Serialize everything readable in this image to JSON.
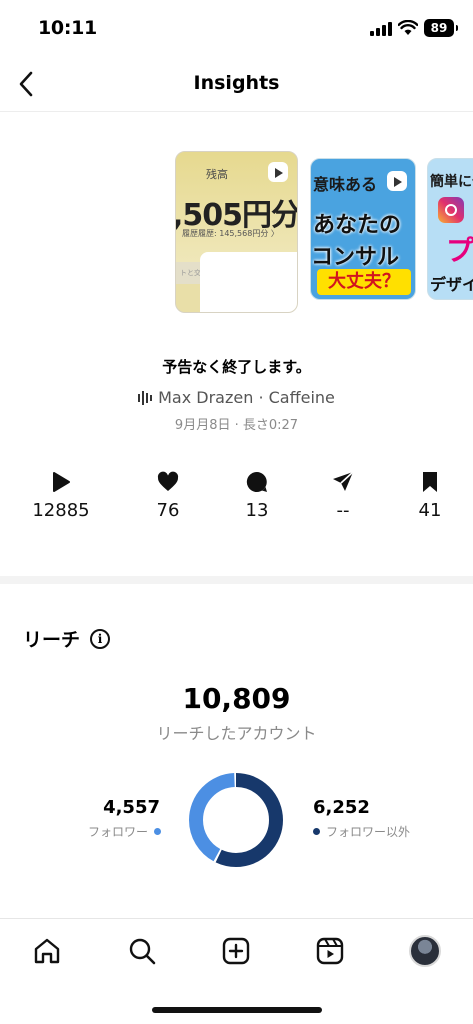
{
  "status_bar": {
    "time": "10:11",
    "battery": "89"
  },
  "nav": {
    "title": "Insights"
  },
  "thumbnails": [
    {
      "label": "残高",
      "amount": ",505円分",
      "history": "履歴履歴: 145,568円分 〉",
      "footer": "トと交換"
    },
    {
      "line1": "意味ある",
      "line2": "あなたの",
      "line3": "コンサル",
      "line4": "大丈夫？"
    },
    {
      "line1": "簡単に作",
      "line2": "プ",
      "line3": "デザイ"
    }
  ],
  "post": {
    "title": "予告なく終了します。",
    "audio": "Max Drazen · Caffeine",
    "meta": "9月月8日 · 長さ0:27"
  },
  "stats": {
    "plays": "12885",
    "likes": "76",
    "comments": "13",
    "shares": "--",
    "saves": "41"
  },
  "reach": {
    "heading": "リーチ",
    "total": "10,809",
    "subtitle": "リーチしたアカウント",
    "followers_value": "4,557",
    "followers_label": "フォロワー",
    "non_followers_value": "6,252",
    "non_followers_label": "フォロワー以外",
    "followers_count": 4557,
    "non_followers_count": 6252,
    "colors": {
      "followers": "#4c8fe3",
      "non_followers": "#17386b"
    }
  },
  "tabbar": {
    "items": [
      "home",
      "search",
      "create",
      "reels",
      "profile"
    ]
  }
}
